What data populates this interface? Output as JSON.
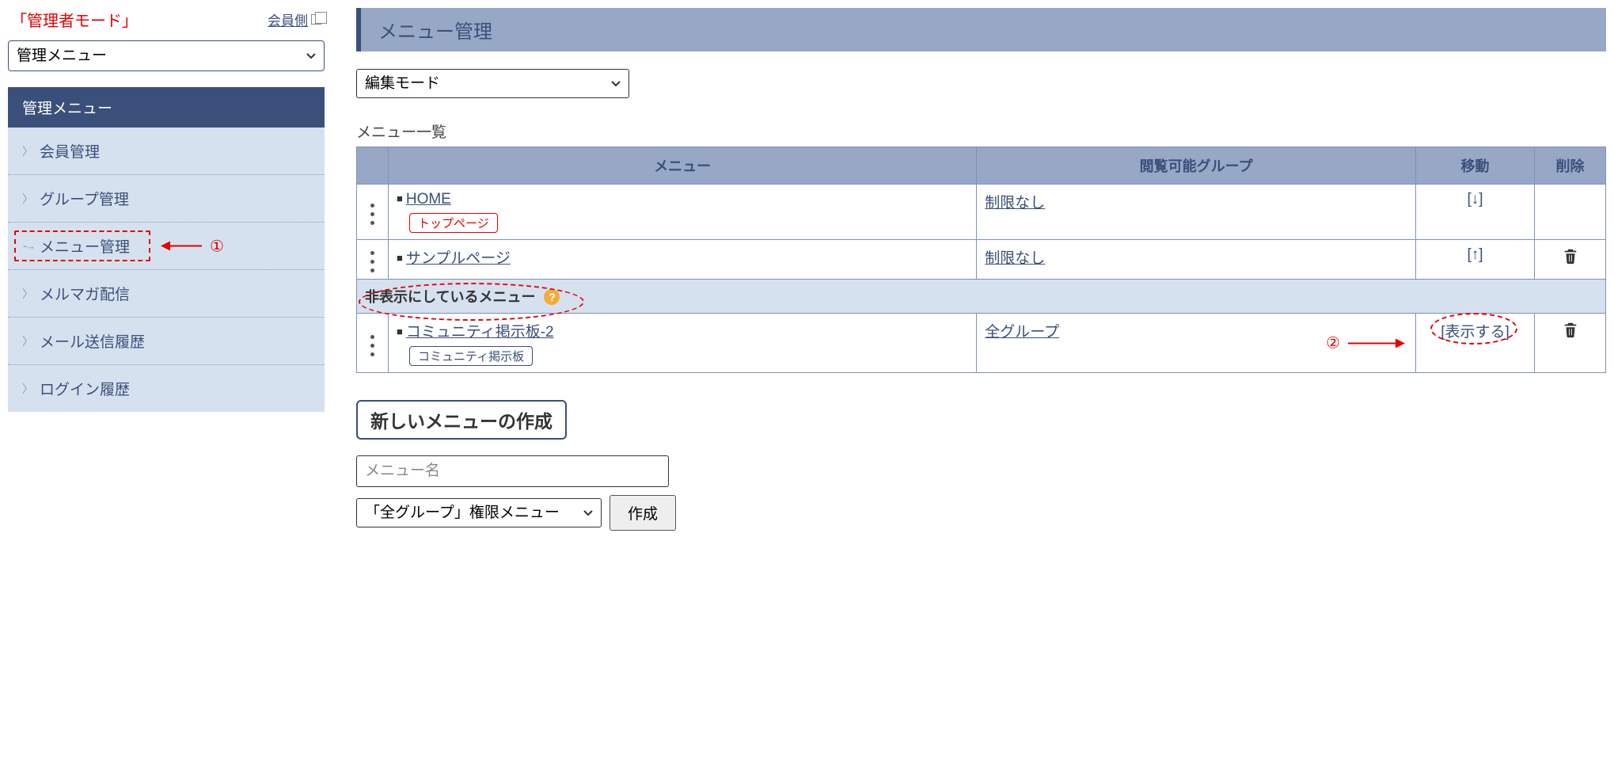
{
  "sidebar": {
    "admin_mode": "「管理者モード」",
    "member_link": "会員側",
    "select_value": "管理メニュー",
    "panel_title": "管理メニュー",
    "items": [
      {
        "label": "会員管理"
      },
      {
        "label": "グループ管理"
      },
      {
        "label": "メニュー管理"
      },
      {
        "label": "メルマガ配信"
      },
      {
        "label": "メール送信履歴"
      },
      {
        "label": "ログイン履歴"
      }
    ]
  },
  "annotations": {
    "num1": "①",
    "num2": "②"
  },
  "main": {
    "title": "メニュー管理",
    "mode_select": "編集モード",
    "list_label": "メニュー一覧",
    "columns": {
      "menu": "メニュー",
      "group": "閲覧可能グループ",
      "move": "移動",
      "delete": "削除"
    },
    "rows": [
      {
        "name": "HOME",
        "tag": "トップページ",
        "tag_type": "top",
        "group": "制限なし",
        "move": "[↓]",
        "deletable": false
      },
      {
        "name": "サンプルページ",
        "tag": null,
        "group": "制限なし",
        "move": "[↑]",
        "deletable": true
      }
    ],
    "hidden_header": "非表示にしているメニュー",
    "help": "?",
    "hidden_rows": [
      {
        "name": "コミュニティ掲示板-2",
        "tag": "コミュニティ掲示板",
        "tag_type": "bbs",
        "group": "全グループ",
        "move": "[表示する]",
        "deletable": true
      }
    ],
    "create": {
      "header": "新しいメニューの作成",
      "placeholder": "メニュー名",
      "select": "「全グループ」権限メニュー",
      "button": "作成"
    }
  }
}
